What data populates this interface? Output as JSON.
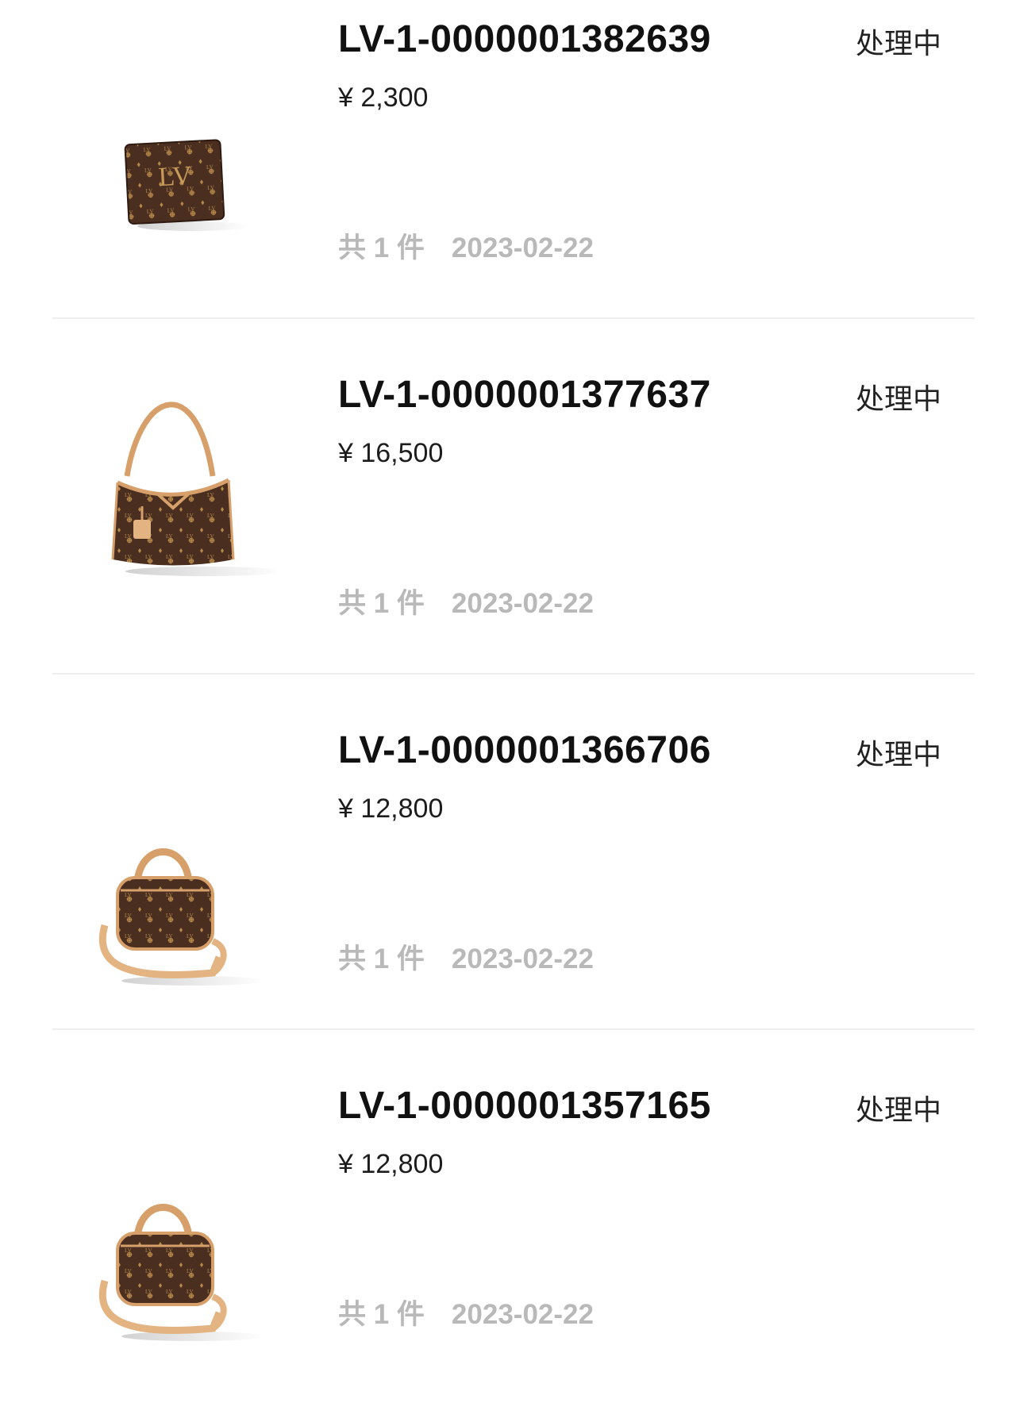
{
  "orders": [
    {
      "order_no": "LV-1-0000001382639",
      "price": "¥ 2,300",
      "status": "处理中",
      "quantity": "共 1 件",
      "date": "2023-02-22",
      "image_icon": "wallet-icon"
    },
    {
      "order_no": "LV-1-0000001377637",
      "price": "¥ 16,500",
      "status": "处理中",
      "quantity": "共 1 件",
      "date": "2023-02-22",
      "image_icon": "hobo-bag-icon"
    },
    {
      "order_no": "LV-1-0000001366706",
      "price": "¥ 12,800",
      "status": "处理中",
      "quantity": "共 1 件",
      "date": "2023-02-22",
      "image_icon": "speedy-bag-icon"
    },
    {
      "order_no": "LV-1-0000001357165",
      "price": "¥ 12,800",
      "status": "处理中",
      "quantity": "共 1 件",
      "date": "2023-02-22",
      "image_icon": "speedy-bag-icon"
    }
  ],
  "colors": {
    "canvas_brown": "#4a2e20",
    "monogram_gold": "#b8894a",
    "leather_tan": "#d7a06b",
    "muted_text": "#b9b9b9",
    "divider": "#eeeeee"
  }
}
